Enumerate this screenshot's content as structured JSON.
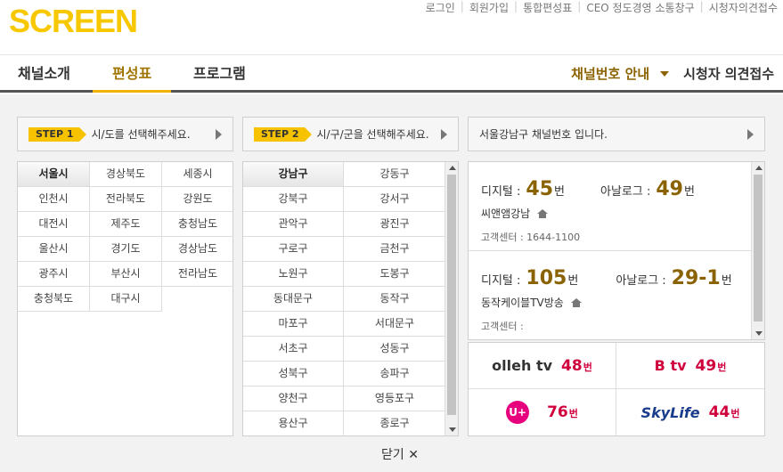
{
  "header": {
    "logo": "SCREEN",
    "links": [
      "로그인",
      "회원가입",
      "통합편성표",
      "CEO 정도경영 소통창구",
      "시청자의견접수"
    ]
  },
  "nav": {
    "tabs": [
      "채널소개",
      "편성표",
      "프로그램"
    ],
    "active": "편성표",
    "channel_guide": "채널번호 안내",
    "viewer": "시청자 의견접수"
  },
  "steps": {
    "step1_badge": "STEP 1",
    "step1_text": "시/도를 선택해주세요.",
    "step2_badge": "STEP 2",
    "step2_text": "시/구/군을 선택해주세요.",
    "result_text": "서울강남구 채널번호 입니다."
  },
  "regions": [
    "서울시",
    "경상북도",
    "세종시",
    "인천시",
    "전라북도",
    "강원도",
    "대전시",
    "제주도",
    "충청남도",
    "울산시",
    "경기도",
    "경상남도",
    "광주시",
    "부산시",
    "전라남도",
    "충청북도",
    "대구시"
  ],
  "selected_region": "서울시",
  "districts": [
    "강남구",
    "강동구",
    "강북구",
    "강서구",
    "관악구",
    "광진구",
    "구로구",
    "금천구",
    "노원구",
    "도봉구",
    "동대문구",
    "동작구",
    "마포구",
    "서대문구",
    "서초구",
    "성동구",
    "성북구",
    "송파구",
    "양천구",
    "영등포구",
    "용산구",
    "종로구"
  ],
  "selected_district": "강남구",
  "channels": [
    {
      "digital_label": "디지털 :",
      "digital": "45",
      "digital_unit": "번",
      "analog_label": "아날로그 :",
      "analog": "49",
      "analog_unit": "번",
      "name": "씨앤앰강남",
      "cs": "고객센터 : 1644-1100"
    },
    {
      "digital_label": "디지털 :",
      "digital": "105",
      "digital_unit": "번",
      "analog_label": "아날로그 :",
      "analog": "29-1",
      "analog_unit": "번",
      "name": "동작케이블TV방송",
      "cs": "고객센터 :"
    }
  ],
  "platforms": [
    {
      "logo": "olleh tv",
      "num": "48",
      "unit": "번",
      "logo_color": "#333333"
    },
    {
      "logo": "B tv",
      "num": "49",
      "unit": "번",
      "logo_color": "#d0003d"
    },
    {
      "logo": "U+",
      "num": "76",
      "unit": "번",
      "logo_color": "#e6007e"
    },
    {
      "logo": "SkyLife",
      "num": "44",
      "unit": "번",
      "logo_color": "#1a3c8c"
    }
  ],
  "close_label": "닫기 ✕",
  "colors": {
    "accent": "#f7c800",
    "active_tab": "#a07400",
    "channel_num": "#8a6200",
    "platform_num": "#d0003d"
  }
}
